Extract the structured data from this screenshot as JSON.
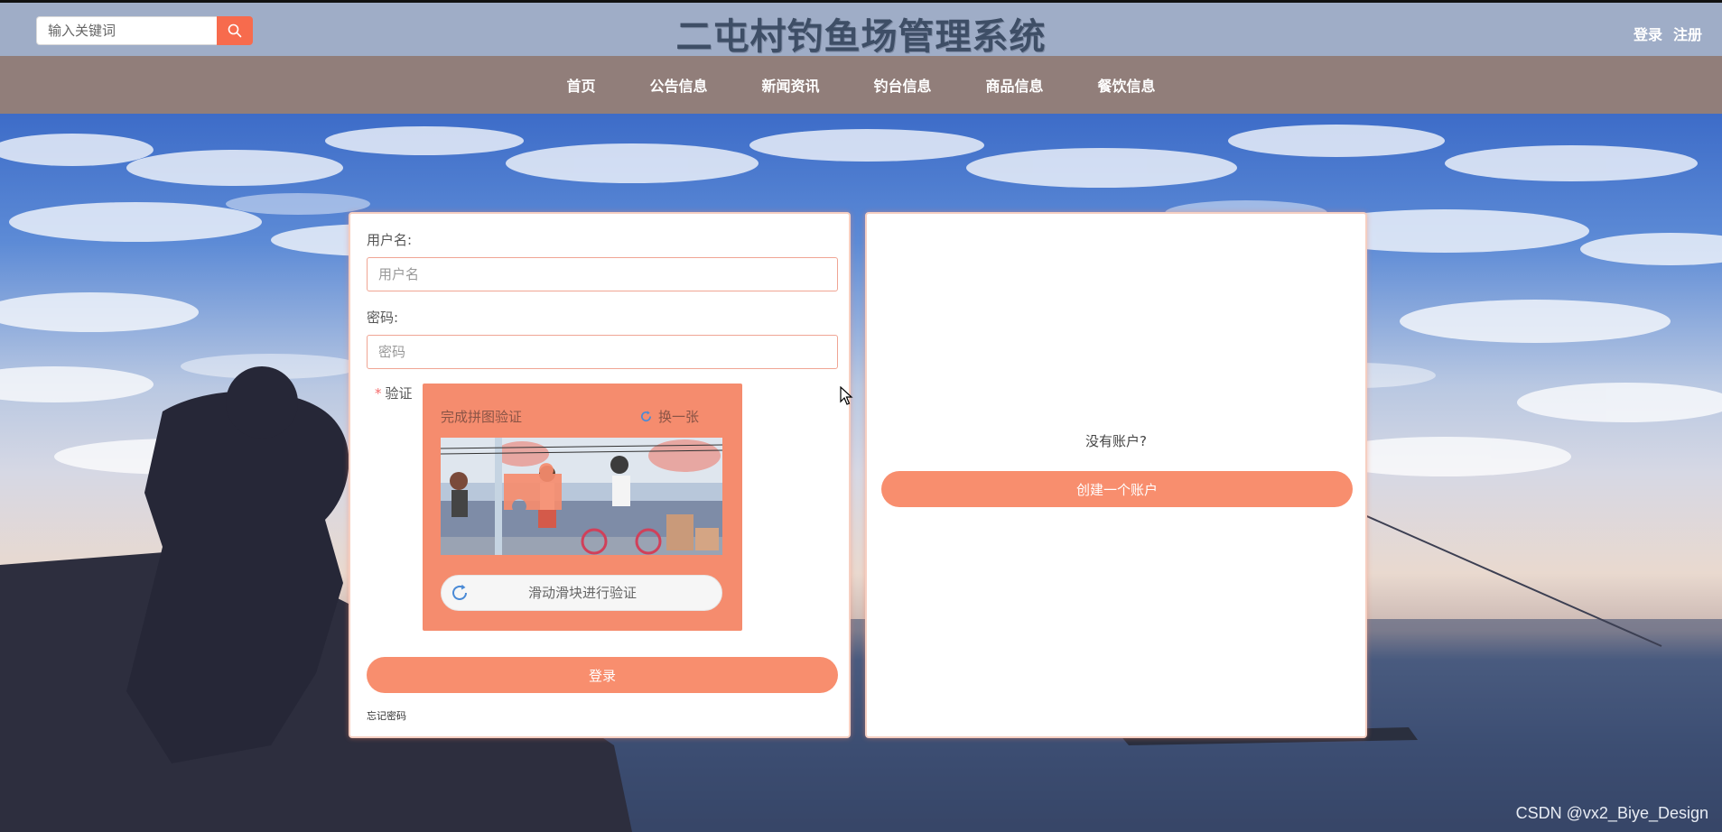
{
  "header": {
    "search_placeholder": "输入关键词",
    "site_title": "二屯村钓鱼场管理系统",
    "login_link": "登录",
    "register_link": "注册"
  },
  "nav": {
    "items": [
      {
        "label": "首页"
      },
      {
        "label": "公告信息"
      },
      {
        "label": "新闻资讯"
      },
      {
        "label": "钓台信息"
      },
      {
        "label": "商品信息"
      },
      {
        "label": "餐饮信息"
      }
    ]
  },
  "login_form": {
    "username_label": "用户名:",
    "username_placeholder": "用户名",
    "password_label": "密码:",
    "password_placeholder": "密码",
    "verify_required_mark": "*",
    "verify_label": "验证",
    "captcha": {
      "title": "完成拼图验证",
      "refresh_label": "换一张",
      "slider_text": "滑动滑块进行验证"
    },
    "login_button": "登录",
    "forgot_password": "忘记密码"
  },
  "register_panel": {
    "no_account_text": "没有账户?",
    "create_account_button": "创建一个账户"
  },
  "watermark": "CSDN @vx2_Biye_Design",
  "colors": {
    "header_bg": "#9fadc7",
    "nav_bg": "#917e7a",
    "accent": "#f88e6e",
    "search_button": "#f76b4d"
  }
}
